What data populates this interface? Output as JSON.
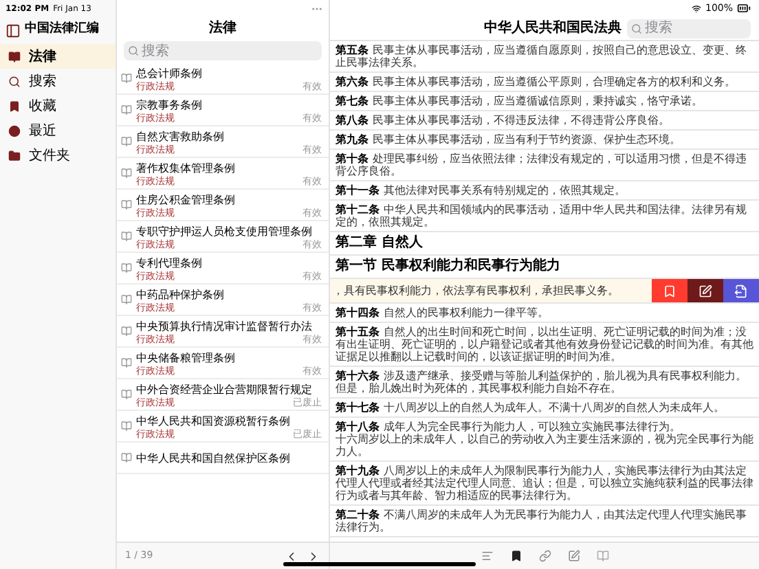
{
  "status_bar": {
    "time": "12:02 PM",
    "date": "Fri Jan 13",
    "battery": "100%"
  },
  "sidebar": {
    "title": "中国法律汇编",
    "items": [
      {
        "label": "法律",
        "selected": true
      },
      {
        "label": "搜索",
        "selected": false
      },
      {
        "label": "收藏",
        "selected": false
      },
      {
        "label": "最近",
        "selected": false
      },
      {
        "label": "文件夹",
        "selected": false
      }
    ]
  },
  "law_list": {
    "title": "法律",
    "search": {
      "placeholder": "搜索"
    },
    "items": [
      {
        "title": "总会计师条例",
        "category": "行政法规",
        "status": "有效"
      },
      {
        "title": "宗教事务条例",
        "category": "行政法规",
        "status": "有效"
      },
      {
        "title": "自然灾害救助条例",
        "category": "行政法规",
        "status": "有效"
      },
      {
        "title": "著作权集体管理条例",
        "category": "行政法规",
        "status": "有效"
      },
      {
        "title": "住房公积金管理条例",
        "category": "行政法规",
        "status": "有效"
      },
      {
        "title": "专职守护押运人员枪支使用管理条例",
        "category": "行政法规",
        "status": "有效"
      },
      {
        "title": "专利代理条例",
        "category": "行政法规",
        "status": "有效"
      },
      {
        "title": "中药品种保护条例",
        "category": "行政法规",
        "status": "有效"
      },
      {
        "title": "中央预算执行情况审计监督暂行办法",
        "category": "行政法规",
        "status": "有效"
      },
      {
        "title": "中央储备粮管理条例",
        "category": "行政法规",
        "status": "有效"
      },
      {
        "title": "中外合资经营企业合营期限暂行规定",
        "category": "行政法规",
        "status": "已废止"
      },
      {
        "title": "中华人民共和国资源税暂行条例",
        "category": "行政法规",
        "status": "已废止"
      },
      {
        "title": "中华人民共和国自然保护区条例"
      }
    ],
    "page": "1 / 39"
  },
  "document": {
    "title": "中华人民共和国民法典",
    "search": {
      "placeholder": "搜索"
    },
    "rows": [
      {
        "kind": "article",
        "label": "第五条",
        "paragraphs": [
          "民事主体从事民事活动，应当遵循自愿原则，按照自己的意思设立、变更、终止民事法律关系。"
        ]
      },
      {
        "kind": "article",
        "label": "第六条",
        "paragraphs": [
          "民事主体从事民事活动，应当遵循公平原则，合理确定各方的权利和义务。"
        ]
      },
      {
        "kind": "article",
        "label": "第七条",
        "paragraphs": [
          "民事主体从事民事活动，应当遵循诚信原则，秉持诚实，恪守承诺。"
        ]
      },
      {
        "kind": "article",
        "label": "第八条",
        "paragraphs": [
          "民事主体从事民事活动，不得违反法律，不得违背公序良俗。"
        ]
      },
      {
        "kind": "article",
        "label": "第九条",
        "paragraphs": [
          "民事主体从事民事活动，应当有利于节约资源、保护生态环境。"
        ]
      },
      {
        "kind": "article",
        "label": "第十条",
        "paragraphs": [
          "处理民事纠纷，应当依照法律；法律没有规定的，可以适用习惯，但是不得违背公序良俗。"
        ]
      },
      {
        "kind": "article",
        "label": "第十一条",
        "paragraphs": [
          "其他法律对民事关系有特别规定的，依照其规定。"
        ]
      },
      {
        "kind": "article",
        "label": "第十二条",
        "paragraphs": [
          "中华人民共和国领域内的民事活动，适用中华人民共和国法律。法律另有规定的，依照其规定。"
        ]
      },
      {
        "kind": "chapter",
        "label": "第二章 自然人"
      },
      {
        "kind": "section",
        "label": "第一节 民事权利能力和民事行为能力"
      },
      {
        "kind": "swiped",
        "text": "，具有民事权利能力，依法享有民事权利，承担民事义务。",
        "actions": [
          {
            "color": "#ff3b30"
          },
          {
            "color": "#6e1a1a"
          },
          {
            "color": "#5856d6"
          }
        ]
      },
      {
        "kind": "article",
        "label": "第十四条",
        "paragraphs": [
          "自然人的民事权利能力一律平等。"
        ]
      },
      {
        "kind": "article",
        "label": "第十五条",
        "paragraphs": [
          "自然人的出生时间和死亡时间，以出生证明、死亡证明记载的时间为准；没有出生证明、死亡证明的，以户籍登记或者其他有效身份登记记载的时间为准。有其他证据足以推翻以上记载时间的，以该证据证明的时间为准。"
        ]
      },
      {
        "kind": "article",
        "label": "第十六条",
        "paragraphs": [
          "涉及遗产继承、接受赠与等胎儿利益保护的，胎儿视为具有民事权利能力。但是，胎儿娩出时为死体的，其民事权利能力自始不存在。"
        ]
      },
      {
        "kind": "article",
        "label": "第十七条",
        "paragraphs": [
          "十八周岁以上的自然人为成年人。不满十八周岁的自然人为未成年人。"
        ]
      },
      {
        "kind": "article",
        "label": "第十八条",
        "paragraphs": [
          "成年人为完全民事行为能力人，可以独立实施民事法律行为。",
          "十六周岁以上的未成年人，以自己的劳动收入为主要生活来源的，视为完全民事行为能力人。"
        ]
      },
      {
        "kind": "article",
        "label": "第十九条",
        "paragraphs": [
          "八周岁以上的未成年人为限制民事行为能力人，实施民事法律行为由其法定代理人代理或者经其法定代理人同意、追认；但是，可以独立实施纯获利益的民事法律行为或者与其年龄、智力相适应的民事法律行为。"
        ]
      },
      {
        "kind": "article",
        "label": "第二十条",
        "paragraphs": [
          "不满八周岁的未成年人为无民事行为能力人，由其法定代理人代理实施民事法律行为。"
        ]
      }
    ]
  }
}
